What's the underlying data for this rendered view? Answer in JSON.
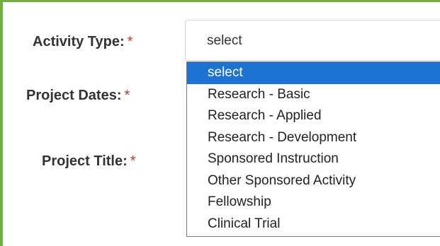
{
  "form": {
    "activity_type": {
      "label": "Activity Type:",
      "required_mark": "*",
      "selected_value": "select"
    },
    "project_dates": {
      "label": "Project Dates:",
      "required_mark": "*"
    },
    "project_title": {
      "label": "Project Title:",
      "required_mark": "*"
    }
  },
  "dropdown": {
    "options": [
      {
        "label": "select",
        "selected": true
      },
      {
        "label": "Research - Basic",
        "selected": false
      },
      {
        "label": "Research - Applied",
        "selected": false
      },
      {
        "label": "Research - Development",
        "selected": false
      },
      {
        "label": "Sponsored Instruction",
        "selected": false
      },
      {
        "label": "Other Sponsored Activity",
        "selected": false
      },
      {
        "label": "Fellowship",
        "selected": false
      },
      {
        "label": "Clinical Trial",
        "selected": false
      }
    ]
  },
  "colors": {
    "frame_border": "#70ad47",
    "selected_option_bg": "#1e73d2",
    "required_mark": "#c0392b"
  }
}
